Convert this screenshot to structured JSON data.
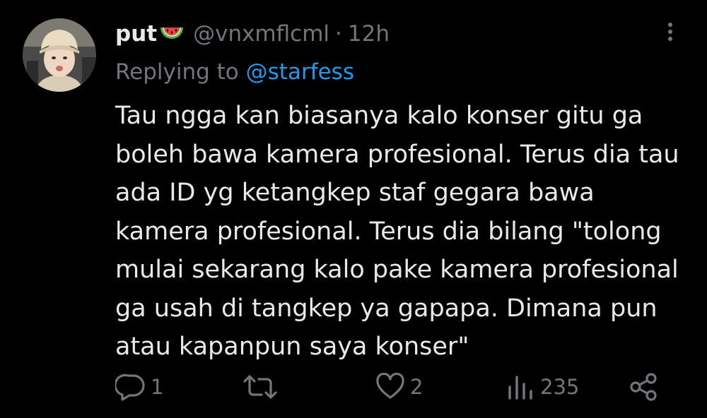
{
  "post": {
    "display_name": "put",
    "name_emoji": "watermelon-emoji",
    "handle": "@vnxmflcml",
    "separator": "·",
    "time": "12h",
    "reply_prefix": "Replying to",
    "reply_to": "@starfess",
    "body_lines": [
      "Tau ngga kan biasanya kalo konser gitu ga",
      "boleh bawa kamera profesional. Terus dia tau",
      "ada ID yg ketangkep staf gegara bawa",
      "kamera profesional. Terus dia bilang \"tolong",
      "mulai sekarang kalo pake kamera profesional",
      "ga usah di tangkep ya gapapa. Dimana pun",
      "atau kapanpun saya konser\""
    ]
  },
  "actions": {
    "reply": {
      "icon": "reply-icon",
      "count": "1"
    },
    "repost": {
      "icon": "repost-icon",
      "count": ""
    },
    "like": {
      "icon": "heart-icon",
      "count": "2"
    },
    "views": {
      "icon": "views-icon",
      "count": "235"
    },
    "share": {
      "icon": "share-icon",
      "count": ""
    }
  },
  "colors": {
    "background": "#000000",
    "text": "#e7e9ea",
    "secondary": "#71767b",
    "link": "#1d9bf0"
  }
}
